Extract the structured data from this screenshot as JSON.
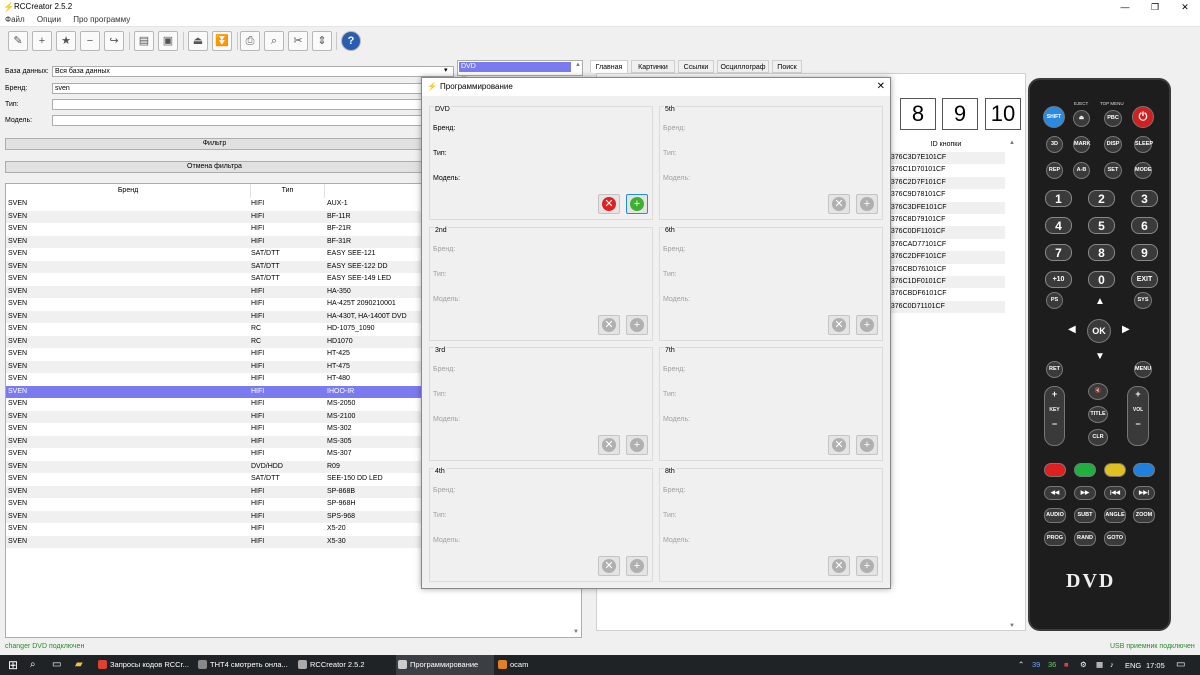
{
  "window": {
    "title": "RCCreator 2.5.2",
    "minimize": "—",
    "maximize": "❐",
    "close": "✕"
  },
  "menu": [
    "Файл",
    "Опции",
    "Про программу"
  ],
  "filter": {
    "database_label": "База данных:",
    "database_value": "Вся база данных",
    "brand_label": "Бренд:",
    "brand_value": "sven",
    "type_label": "Тип:",
    "type_value": "",
    "model_label": "Модель:",
    "model_value": "",
    "filter_button": "Фильтр",
    "cancel_button": "Отмена фильтра"
  },
  "grid": {
    "headers": [
      "Бренд",
      "Тип"
    ],
    "rows": [
      [
        "SVEN",
        "HIFI",
        "AUX-1"
      ],
      [
        "SVEN",
        "HIFI",
        "BF-11R"
      ],
      [
        "SVEN",
        "HIFI",
        "BF-21R"
      ],
      [
        "SVEN",
        "HIFI",
        "BF-31R"
      ],
      [
        "SVEN",
        "SAT/DTT",
        "EASY SEE-121"
      ],
      [
        "SVEN",
        "SAT/DTT",
        "EASY SEE-122 DD"
      ],
      [
        "SVEN",
        "SAT/DTT",
        "EASY SEE-149 LED"
      ],
      [
        "SVEN",
        "HIFI",
        "HA-350"
      ],
      [
        "SVEN",
        "HIFI",
        "HA-425T 2090210001"
      ],
      [
        "SVEN",
        "HIFI",
        "HA-430T, HA-1400T DVD"
      ],
      [
        "SVEN",
        "RC",
        "HD-1075_1090"
      ],
      [
        "SVEN",
        "RC",
        "HD1070"
      ],
      [
        "SVEN",
        "HIFI",
        "HT-425"
      ],
      [
        "SVEN",
        "HIFI",
        "HT-475"
      ],
      [
        "SVEN",
        "HIFI",
        "HT-480"
      ],
      [
        "SVEN",
        "HIFI",
        "IHOO-IR"
      ],
      [
        "SVEN",
        "HIFI",
        "MS-2050"
      ],
      [
        "SVEN",
        "HIFI",
        "MS-2100"
      ],
      [
        "SVEN",
        "HIFI",
        "MS-302"
      ],
      [
        "SVEN",
        "HIFI",
        "MS-305"
      ],
      [
        "SVEN",
        "HIFI",
        "MS-307"
      ],
      [
        "SVEN",
        "DVD/HDD",
        "R09"
      ],
      [
        "SVEN",
        "SAT/DTT",
        "SEE-150 DD LED"
      ],
      [
        "SVEN",
        "HIFI",
        "SP-868B"
      ],
      [
        "SVEN",
        "HIFI",
        "SP-968H"
      ],
      [
        "SVEN",
        "HIFI",
        "SPS-968"
      ],
      [
        "SVEN",
        "HIFI",
        "X5-20"
      ],
      [
        "SVEN",
        "HIFI",
        "X5-30"
      ]
    ],
    "selected_index": 15
  },
  "device_list": {
    "selected": "DVD",
    "next_partial": "…"
  },
  "tabs": [
    "Главная",
    "Картинки",
    "Ссылки",
    "Осциллограф",
    "Поиск"
  ],
  "dialog": {
    "title": "Программирование",
    "field_brand": "Бренд:",
    "field_type": "Тип:",
    "field_model": "Модель:",
    "slots": [
      "DVD",
      "5th",
      "2nd",
      "6th",
      "3rd",
      "7th",
      "4th",
      "8th"
    ],
    "close": "✕"
  },
  "digits": [
    "8",
    "9",
    "10"
  ],
  "id_header": "ID кнопки",
  "ids": [
    "8376C3D7E101CF",
    "8376C1D70101CF",
    "8376C2D7F101CF",
    "8376C9D78101CF",
    "8376C3DFE101CF",
    "8376C8D79101CF",
    "8376C0DF1101CF",
    "8376CAD77101CF",
    "8376C2DFF101CF",
    "8376CBD76101CF",
    "8376C1DF0101CF",
    "8376CBDF6101CF",
    "8376C0D71101CF"
  ],
  "remote": {
    "brand_label": "DVD"
  },
  "status": {
    "left": "changer DVD подключен",
    "right": "USB приемник подключен"
  },
  "taskbar": {
    "items": [
      "Запросы кодов RCCr...",
      "THT4 смотреть онла...",
      "RCCreator 2.5.2",
      "Программирование",
      "ocam"
    ],
    "tray": {
      "lang": "ENG",
      "time": "17:05",
      "n1": "39",
      "n2": "36"
    }
  },
  "colors": {
    "selection": "#7b7bf0",
    "status_text": "#2a8a2a",
    "remove": "#e02020",
    "add": "#3cb030"
  }
}
